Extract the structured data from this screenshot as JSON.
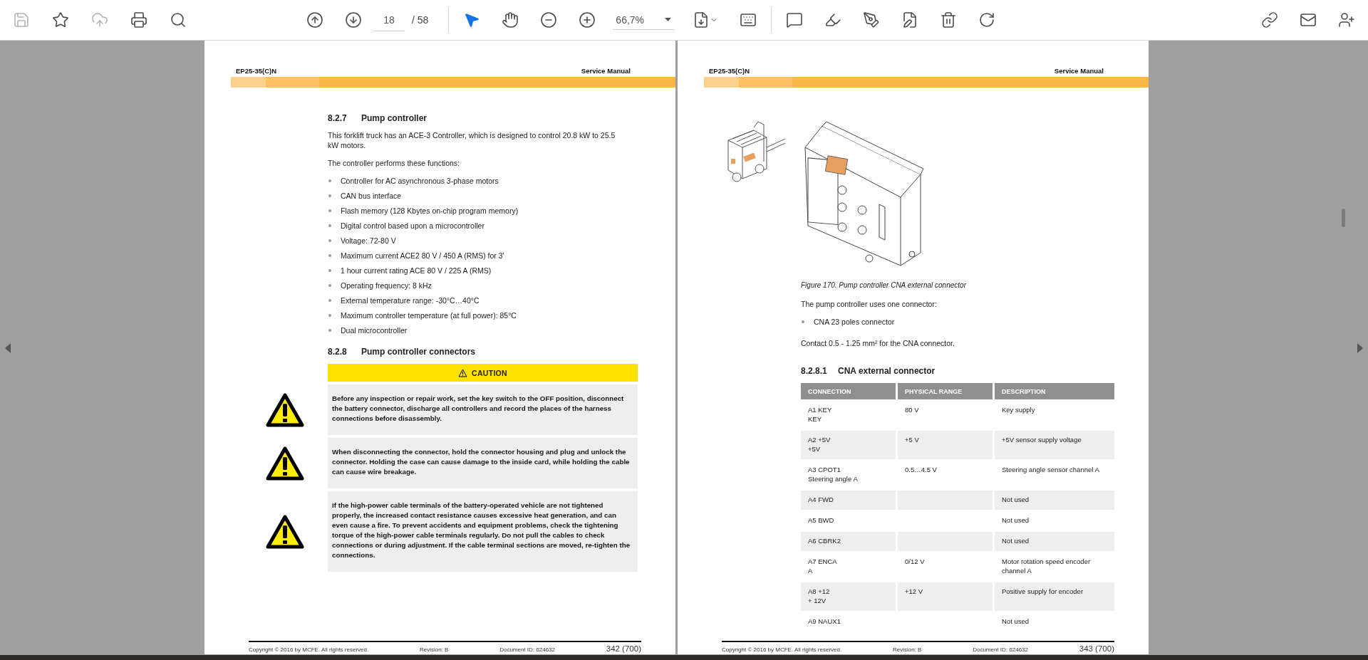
{
  "toolbar": {
    "file_tools": [
      {
        "disabled": true
      },
      {
        "disabled": false
      },
      {
        "disabled": true
      },
      {
        "disabled": false
      },
      {
        "disabled": false
      }
    ],
    "page_field": {
      "value": "18"
    },
    "page_total": "/ 58",
    "pointer_tools": [
      {
        "selected": true
      },
      {
        "selected": false
      }
    ],
    "zoom_field": {
      "value": "66,7%"
    }
  },
  "pages": [
    {
      "header": {
        "model": "EP25-35(C)N",
        "title": "Service Manual"
      },
      "blocks": [
        {
          "kind": "heading",
          "number": "8.2.7",
          "title": "Pump controller"
        },
        {
          "kind": "paragraph",
          "text": "This forklift truck has an ACE-3 Controller, which is designed to control 20.8 kW to 25.5 kW motors."
        },
        {
          "kind": "paragraph",
          "text": "The controller performs these functions:"
        },
        {
          "kind": "bullets",
          "items": [
            "Controller for AC asynchronous 3-phase motors",
            "CAN bus interface",
            "Flash memory (128 Kbytes on-chip program memory)",
            "Digital control based upon a microcontroller",
            "Voltage: 72-80 V",
            "Maximum current ACE2 80 V / 450 A (RMS) for 3'",
            "1 hour current rating ACE 80 V / 225 A (RMS)",
            "Operating frequency: 8 kHz",
            "External temperature range: -30°C…40°C",
            "Maximum controller temperature (at full power): 85°C",
            "Dual microcontroller"
          ]
        },
        {
          "kind": "heading",
          "number": "8.2.8",
          "title": "Pump controller connectors"
        },
        {
          "kind": "caution",
          "label": "CAUTION",
          "warnings": [
            "Before any inspection or repair work, set the key switch to the OFF position, disconnect the battery connector, discharge all controllers and record the places of the harness connections before disassembly.",
            "When disconnecting the connector, hold the connector housing and plug and unlock the connector. Holding the case can cause damage to the inside card, while holding the cable can cause wire breakage.",
            "If the high-power cable terminals of the battery-operated vehicle are not tightened properly, the increased contact resistance causes excessive heat generation, and can even cause a fire. To prevent accidents and equipment problems, check the tightening torque of the high-power cable terminals regularly. Do not pull the cables to check connections or during adjustment. If the cable terminal sections are moved, re-tighten the connections."
          ]
        }
      ],
      "footer": {
        "copyright": "Copyright © 2016 by MCFE. All rights reserved.",
        "revision": "Revision: B",
        "document_id": "Document ID: 624632",
        "page_number": "342 (700)"
      }
    },
    {
      "header": {
        "model": "EP25-35(C)N",
        "title": "Service Manual"
      },
      "blocks": [
        {
          "kind": "figure"
        },
        {
          "kind": "caption",
          "text": "Figure 170. Pump controller CNA external connector"
        },
        {
          "kind": "paragraph",
          "text": "The pump controller uses one connector:"
        },
        {
          "kind": "bullets",
          "items": [
            "CNA 23 poles connector"
          ]
        },
        {
          "kind": "paragraph",
          "text": "Contact 0.5 - 1.25 mm² for the CNA connector."
        },
        {
          "kind": "subheading",
          "number": "8.2.8.1",
          "title": "CNA external connector"
        },
        {
          "kind": "table",
          "columns": [
            "CONNECTION",
            "PHYSICAL RANGE",
            "DESCRIPTION"
          ],
          "rows": [
            [
              "A1 KEY\nKEY",
              "80 V",
              "Key supply"
            ],
            [
              "A2 +5V\n+5V",
              "+5 V",
              "+5V sensor supply voltage"
            ],
            [
              "A3 CPOT1\nSteering angle A",
              "0.5…4.5 V",
              "Steering angle sensor channel A"
            ],
            [
              "A4 FWD",
              "",
              "Not used"
            ],
            [
              "A5 BWD",
              "",
              "Not used"
            ],
            [
              "A6 CBRK2",
              "",
              "Not used"
            ],
            [
              "A7 ENCA\nA",
              "0/12 V",
              "Motor rotation speed encoder channel A"
            ],
            [
              "A8 +12\n+ 12V",
              "+12 V",
              "Positive supply for encoder"
            ],
            [
              "A9 NAUX1",
              "",
              "Not used"
            ]
          ]
        }
      ],
      "footer": {
        "copyright": "Copyright © 2016 by MCFE. All rights reserved.",
        "revision": "Revision: B",
        "document_id": "Document ID: 624632",
        "page_number": "343 (700)"
      }
    }
  ]
}
